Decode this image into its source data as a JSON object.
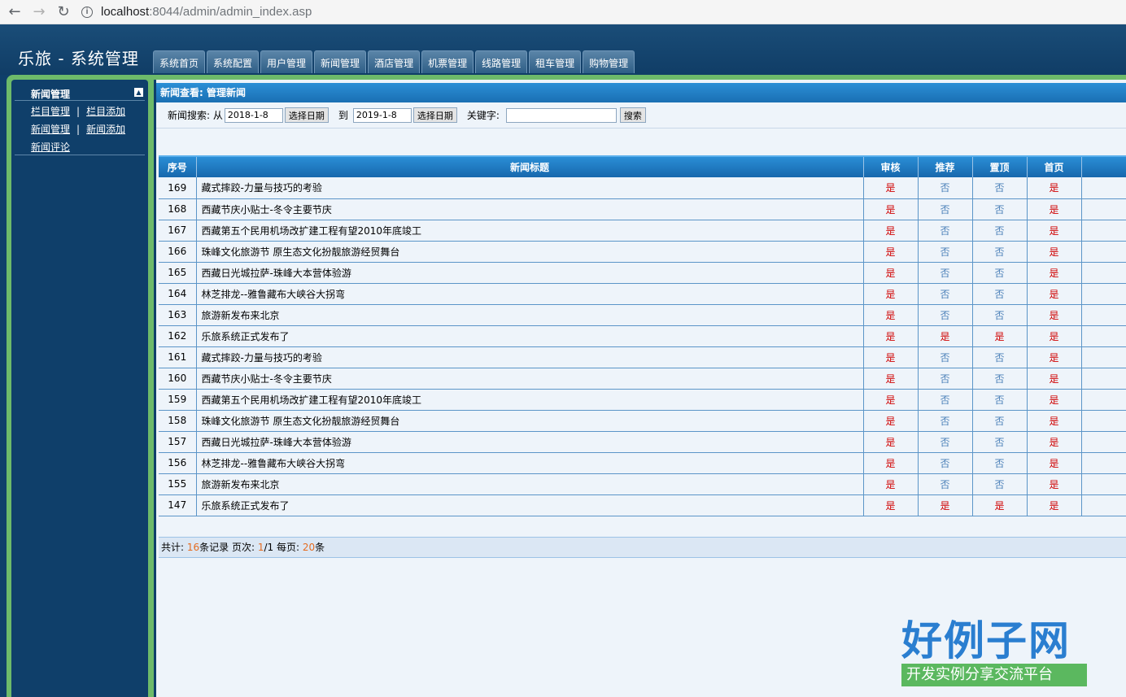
{
  "browser": {
    "url_host": "localhost",
    "url_path": ":8044/admin/admin_index.asp"
  },
  "header": {
    "title": "乐旅 - 系统管理",
    "tabs": [
      "系统首页",
      "系统配置",
      "用户管理",
      "新闻管理",
      "酒店管理",
      "机票管理",
      "线路管理",
      "租车管理",
      "购物管理"
    ]
  },
  "sidebar": {
    "section_title": "新闻管理",
    "rows": [
      [
        "栏目管理",
        "栏目添加"
      ],
      [
        "新闻管理",
        "新闻添加"
      ],
      [
        "新闻评论"
      ]
    ],
    "separator": "|"
  },
  "main": {
    "title": "新闻查看: 管理新闻",
    "search": {
      "label": "新闻搜索: 从",
      "from_date": "2018-1-8",
      "pick_date_label": "选择日期",
      "to_label": "到",
      "to_date": "2019-1-8",
      "keyword_label": "关键字:",
      "keyword_value": "",
      "search_button": "搜索"
    },
    "table": {
      "headers": [
        "序号",
        "新闻标题",
        "审核",
        "推荐",
        "置顶",
        "首页"
      ],
      "rows": [
        {
          "id": "169",
          "title": "藏式摔跤-力量与技巧的考验",
          "flags": [
            "是",
            "否",
            "否",
            "是"
          ]
        },
        {
          "id": "168",
          "title": "西藏节庆小贴士-冬令主要节庆",
          "flags": [
            "是",
            "否",
            "否",
            "是"
          ]
        },
        {
          "id": "167",
          "title": "西藏第五个民用机场改扩建工程有望2010年底竣工",
          "flags": [
            "是",
            "否",
            "否",
            "是"
          ]
        },
        {
          "id": "166",
          "title": "珠峰文化旅游节 原生态文化扮靓旅游经贸舞台",
          "flags": [
            "是",
            "否",
            "否",
            "是"
          ]
        },
        {
          "id": "165",
          "title": "西藏日光城拉萨-珠峰大本营体验游",
          "flags": [
            "是",
            "否",
            "否",
            "是"
          ]
        },
        {
          "id": "164",
          "title": "林芝排龙--雅鲁藏布大峡谷大拐弯",
          "flags": [
            "是",
            "否",
            "否",
            "是"
          ]
        },
        {
          "id": "163",
          "title": "旅游新发布来北京",
          "flags": [
            "是",
            "否",
            "否",
            "是"
          ]
        },
        {
          "id": "162",
          "title": "乐旅系统正式发布了",
          "flags": [
            "是",
            "是",
            "是",
            "是"
          ]
        },
        {
          "id": "161",
          "title": "藏式摔跤-力量与技巧的考验",
          "flags": [
            "是",
            "否",
            "否",
            "是"
          ]
        },
        {
          "id": "160",
          "title": "西藏节庆小贴士-冬令主要节庆",
          "flags": [
            "是",
            "否",
            "否",
            "是"
          ]
        },
        {
          "id": "159",
          "title": "西藏第五个民用机场改扩建工程有望2010年底竣工",
          "flags": [
            "是",
            "否",
            "否",
            "是"
          ]
        },
        {
          "id": "158",
          "title": "珠峰文化旅游节 原生态文化扮靓旅游经贸舞台",
          "flags": [
            "是",
            "否",
            "否",
            "是"
          ]
        },
        {
          "id": "157",
          "title": "西藏日光城拉萨-珠峰大本营体验游",
          "flags": [
            "是",
            "否",
            "否",
            "是"
          ]
        },
        {
          "id": "156",
          "title": "林芝排龙--雅鲁藏布大峡谷大拐弯",
          "flags": [
            "是",
            "否",
            "否",
            "是"
          ]
        },
        {
          "id": "155",
          "title": "旅游新发布来北京",
          "flags": [
            "是",
            "否",
            "否",
            "是"
          ]
        },
        {
          "id": "147",
          "title": "乐旅系统正式发布了",
          "flags": [
            "是",
            "是",
            "是",
            "是"
          ]
        }
      ]
    },
    "footer": {
      "total_label": "共计: ",
      "total": "16",
      "records_label": "条记录 页次: ",
      "page": "1",
      "page_sep": "/1 每页: ",
      "per_page": "20",
      "per_page_suffix": "条"
    }
  },
  "watermark": {
    "logo_text": "好例子网",
    "logo_subtext": "开发实例分享交流平台"
  },
  "colors": {
    "header_bg": "#103d66",
    "accent_blue": "#1a6fb3",
    "frame_green": "#6dba6a",
    "yes_red": "#d00000",
    "no_blue": "#4a7fb8",
    "count_orange": "#e56b1f"
  }
}
